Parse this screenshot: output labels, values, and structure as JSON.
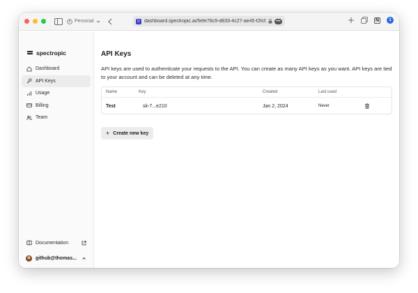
{
  "browser": {
    "profile_label": "Personal",
    "url": "dashboard.spectropic.ai/5efe78c9-d833-4c27-ae45-f2fcf2",
    "favicon_letter": "D",
    "more_label": "•••",
    "icons": [
      "sidebar-icon",
      "back-icon",
      "lock-icon",
      "plus-icon",
      "tabs-icon",
      "notion-icon",
      "password-icon"
    ]
  },
  "sidebar": {
    "brand": "spectropic",
    "items": [
      {
        "label": "Dashboard",
        "icon": "home-icon",
        "active": false
      },
      {
        "label": "API Keys",
        "icon": "key-icon",
        "active": true
      },
      {
        "label": "Usage",
        "icon": "chart-icon",
        "active": false
      },
      {
        "label": "Billing",
        "icon": "card-icon",
        "active": false
      },
      {
        "label": "Team",
        "icon": "team-icon",
        "active": false
      }
    ],
    "documentation_label": "Documentation",
    "user_label": "github@thomas..."
  },
  "main": {
    "title": "API Keys",
    "description": "API keys are used to authenticate your requests to the API. You can create as many API keys as you want. API keys are tied to your account and can be deleted at any time.",
    "table": {
      "headers": {
        "name": "Name",
        "key": "Key",
        "created": "Created",
        "last_used": "Last used"
      },
      "rows": [
        {
          "name": "Test",
          "key": "sk-7...e210",
          "created": "Jan 2, 2024",
          "last_used": "Never"
        }
      ]
    },
    "create_button": "Create new key"
  },
  "colors": {
    "accent": "#3c3cc8",
    "active_nav_bg": "#ececec",
    "sidebar_bg": "#fafafa"
  }
}
